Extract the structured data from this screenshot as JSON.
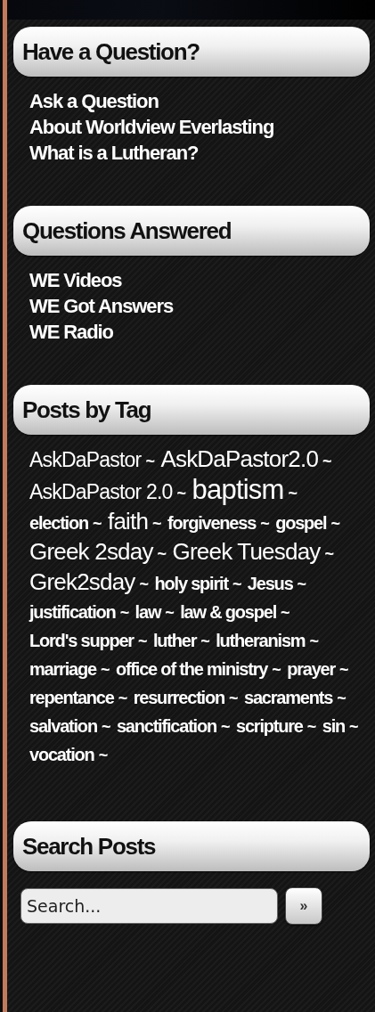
{
  "sections": [
    {
      "title": "Have a Question?",
      "kind": "links",
      "links": [
        "Ask a Question",
        "About Worldview Everlasting",
        "What is a Lutheran?"
      ]
    },
    {
      "title": "Questions Answered",
      "kind": "links",
      "links": [
        "WE Videos",
        "WE Got Answers",
        "WE Radio"
      ]
    },
    {
      "title": "Posts by Tag",
      "kind": "tags",
      "tags": [
        {
          "label": "AskDaPastor",
          "kind": "medium",
          "separator": "~"
        },
        {
          "label": "AskDaPastor2.0",
          "kind": "large",
          "separator": "~"
        },
        {
          "label": "AskDaPastor 2.0",
          "kind": "medium",
          "separator": "~"
        },
        {
          "label": "baptism",
          "kind": "xlarge",
          "separator": "~"
        },
        {
          "label": "election",
          "kind": "small",
          "separator": "~"
        },
        {
          "label": "faith",
          "kind": "large",
          "separator": "~"
        },
        {
          "label": "forgiveness",
          "kind": "small",
          "separator": "~"
        },
        {
          "label": "gospel",
          "kind": "small",
          "separator": "~"
        },
        {
          "label": "Greek 2sday",
          "kind": "large",
          "separator": "~"
        },
        {
          "label": "Greek Tuesday",
          "kind": "large",
          "separator": "~"
        },
        {
          "label": "Grek2sday",
          "kind": "large",
          "separator": "~"
        },
        {
          "label": "holy spirit",
          "kind": "small",
          "separator": "~"
        },
        {
          "label": "Jesus",
          "kind": "small",
          "separator": "~"
        },
        {
          "label": "justification",
          "kind": "small",
          "separator": "~"
        },
        {
          "label": "law",
          "kind": "small",
          "separator": "~"
        },
        {
          "label": "law & gospel",
          "kind": "small",
          "separator": "~"
        },
        {
          "label": "Lord's supper",
          "kind": "small",
          "separator": "~"
        },
        {
          "label": "luther",
          "kind": "small",
          "separator": "~"
        },
        {
          "label": "lutheranism",
          "kind": "small",
          "separator": "~"
        },
        {
          "label": "marriage",
          "kind": "small",
          "separator": "~"
        },
        {
          "label": "office of the ministry",
          "kind": "small",
          "separator": "~"
        },
        {
          "label": "prayer",
          "kind": "small",
          "separator": "~"
        },
        {
          "label": "repentance",
          "kind": "small",
          "separator": "~"
        },
        {
          "label": "resurrection",
          "kind": "small",
          "separator": "~"
        },
        {
          "label": "sacraments",
          "kind": "small",
          "separator": "~"
        },
        {
          "label": "salvation",
          "kind": "small",
          "separator": "~"
        },
        {
          "label": "sanctification",
          "kind": "small",
          "separator": "~"
        },
        {
          "label": "scripture",
          "kind": "small",
          "separator": "~"
        },
        {
          "label": "sin",
          "kind": "small",
          "separator": "~"
        },
        {
          "label": "vocation",
          "kind": "small",
          "separator": "~"
        }
      ]
    },
    {
      "title": "Search Posts",
      "kind": "search",
      "search": {
        "placeholder": "Search...",
        "button": "»"
      }
    }
  ]
}
